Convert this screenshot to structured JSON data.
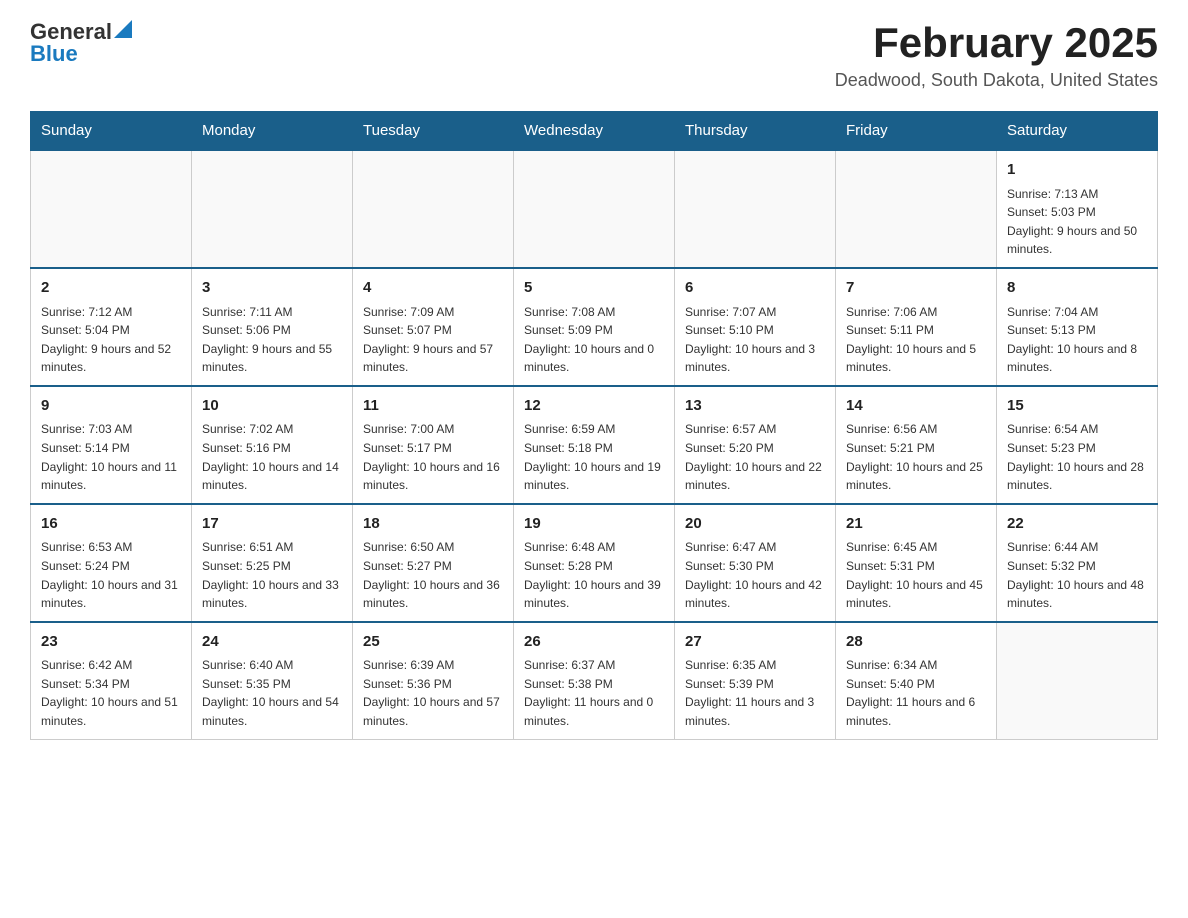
{
  "header": {
    "logo_general": "General",
    "logo_blue": "Blue",
    "title": "February 2025",
    "subtitle": "Deadwood, South Dakota, United States"
  },
  "days_of_week": [
    "Sunday",
    "Monday",
    "Tuesday",
    "Wednesday",
    "Thursday",
    "Friday",
    "Saturday"
  ],
  "weeks": [
    {
      "days": [
        {
          "num": "",
          "info": ""
        },
        {
          "num": "",
          "info": ""
        },
        {
          "num": "",
          "info": ""
        },
        {
          "num": "",
          "info": ""
        },
        {
          "num": "",
          "info": ""
        },
        {
          "num": "",
          "info": ""
        },
        {
          "num": "1",
          "info": "Sunrise: 7:13 AM\nSunset: 5:03 PM\nDaylight: 9 hours and 50 minutes."
        }
      ]
    },
    {
      "days": [
        {
          "num": "2",
          "info": "Sunrise: 7:12 AM\nSunset: 5:04 PM\nDaylight: 9 hours and 52 minutes."
        },
        {
          "num": "3",
          "info": "Sunrise: 7:11 AM\nSunset: 5:06 PM\nDaylight: 9 hours and 55 minutes."
        },
        {
          "num": "4",
          "info": "Sunrise: 7:09 AM\nSunset: 5:07 PM\nDaylight: 9 hours and 57 minutes."
        },
        {
          "num": "5",
          "info": "Sunrise: 7:08 AM\nSunset: 5:09 PM\nDaylight: 10 hours and 0 minutes."
        },
        {
          "num": "6",
          "info": "Sunrise: 7:07 AM\nSunset: 5:10 PM\nDaylight: 10 hours and 3 minutes."
        },
        {
          "num": "7",
          "info": "Sunrise: 7:06 AM\nSunset: 5:11 PM\nDaylight: 10 hours and 5 minutes."
        },
        {
          "num": "8",
          "info": "Sunrise: 7:04 AM\nSunset: 5:13 PM\nDaylight: 10 hours and 8 minutes."
        }
      ]
    },
    {
      "days": [
        {
          "num": "9",
          "info": "Sunrise: 7:03 AM\nSunset: 5:14 PM\nDaylight: 10 hours and 11 minutes."
        },
        {
          "num": "10",
          "info": "Sunrise: 7:02 AM\nSunset: 5:16 PM\nDaylight: 10 hours and 14 minutes."
        },
        {
          "num": "11",
          "info": "Sunrise: 7:00 AM\nSunset: 5:17 PM\nDaylight: 10 hours and 16 minutes."
        },
        {
          "num": "12",
          "info": "Sunrise: 6:59 AM\nSunset: 5:18 PM\nDaylight: 10 hours and 19 minutes."
        },
        {
          "num": "13",
          "info": "Sunrise: 6:57 AM\nSunset: 5:20 PM\nDaylight: 10 hours and 22 minutes."
        },
        {
          "num": "14",
          "info": "Sunrise: 6:56 AM\nSunset: 5:21 PM\nDaylight: 10 hours and 25 minutes."
        },
        {
          "num": "15",
          "info": "Sunrise: 6:54 AM\nSunset: 5:23 PM\nDaylight: 10 hours and 28 minutes."
        }
      ]
    },
    {
      "days": [
        {
          "num": "16",
          "info": "Sunrise: 6:53 AM\nSunset: 5:24 PM\nDaylight: 10 hours and 31 minutes."
        },
        {
          "num": "17",
          "info": "Sunrise: 6:51 AM\nSunset: 5:25 PM\nDaylight: 10 hours and 33 minutes."
        },
        {
          "num": "18",
          "info": "Sunrise: 6:50 AM\nSunset: 5:27 PM\nDaylight: 10 hours and 36 minutes."
        },
        {
          "num": "19",
          "info": "Sunrise: 6:48 AM\nSunset: 5:28 PM\nDaylight: 10 hours and 39 minutes."
        },
        {
          "num": "20",
          "info": "Sunrise: 6:47 AM\nSunset: 5:30 PM\nDaylight: 10 hours and 42 minutes."
        },
        {
          "num": "21",
          "info": "Sunrise: 6:45 AM\nSunset: 5:31 PM\nDaylight: 10 hours and 45 minutes."
        },
        {
          "num": "22",
          "info": "Sunrise: 6:44 AM\nSunset: 5:32 PM\nDaylight: 10 hours and 48 minutes."
        }
      ]
    },
    {
      "days": [
        {
          "num": "23",
          "info": "Sunrise: 6:42 AM\nSunset: 5:34 PM\nDaylight: 10 hours and 51 minutes."
        },
        {
          "num": "24",
          "info": "Sunrise: 6:40 AM\nSunset: 5:35 PM\nDaylight: 10 hours and 54 minutes."
        },
        {
          "num": "25",
          "info": "Sunrise: 6:39 AM\nSunset: 5:36 PM\nDaylight: 10 hours and 57 minutes."
        },
        {
          "num": "26",
          "info": "Sunrise: 6:37 AM\nSunset: 5:38 PM\nDaylight: 11 hours and 0 minutes."
        },
        {
          "num": "27",
          "info": "Sunrise: 6:35 AM\nSunset: 5:39 PM\nDaylight: 11 hours and 3 minutes."
        },
        {
          "num": "28",
          "info": "Sunrise: 6:34 AM\nSunset: 5:40 PM\nDaylight: 11 hours and 6 minutes."
        },
        {
          "num": "",
          "info": ""
        }
      ]
    }
  ]
}
